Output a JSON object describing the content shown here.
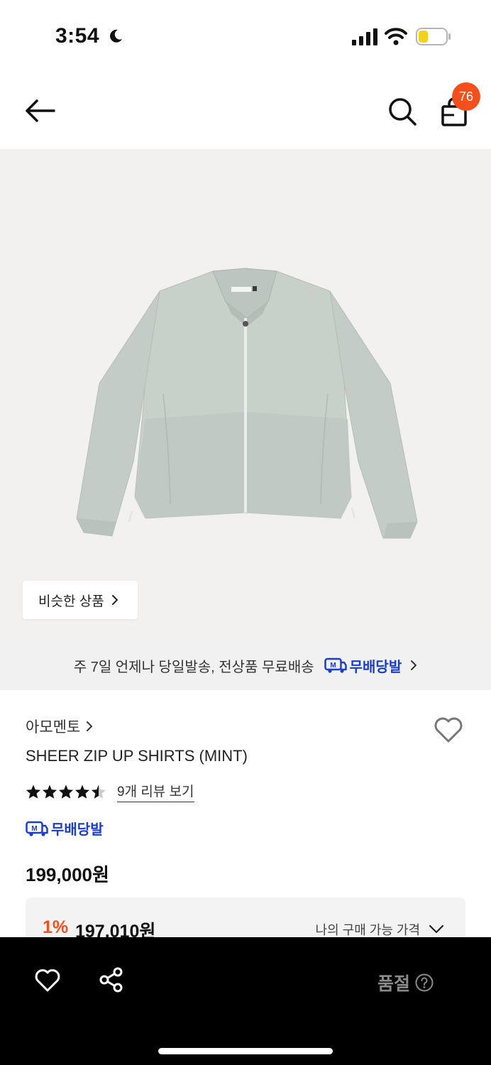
{
  "status_bar": {
    "time": "3:54",
    "icons": [
      "moon-icon",
      "signal-icon",
      "wifi-icon",
      "battery-icon"
    ],
    "battery_color": "#f5d21a"
  },
  "header": {
    "back_icon": "arrow-left-icon",
    "search_icon": "search-icon",
    "cart_icon": "shopping-bag-icon",
    "cart_count": "76",
    "badge_color": "#f4501e"
  },
  "product_image": {
    "similar_button_label": "비슷한 상품"
  },
  "shipping_banner": {
    "text": "주 7일 언제나 당일발송, 전상품 무료배송",
    "logo_label": "무배당발",
    "logo_color": "#1a3ec7"
  },
  "product": {
    "brand": "아모멘토",
    "name": "SHEER ZIP UP SHIRTS (MINT)",
    "rating": 4.5,
    "rating_max": 5,
    "review_link": "9개 리뷰 보기",
    "badge_label": "무배당발",
    "price": "199,000원",
    "discount_percent": "1%",
    "discount_price": "197,010원",
    "my_price_label": "나의 구매 가능 가격"
  },
  "bottom_bar": {
    "heart_icon": "heart-icon",
    "share_icon": "share-icon",
    "soldout_label": "품절",
    "help_icon": "question-circle-icon"
  }
}
